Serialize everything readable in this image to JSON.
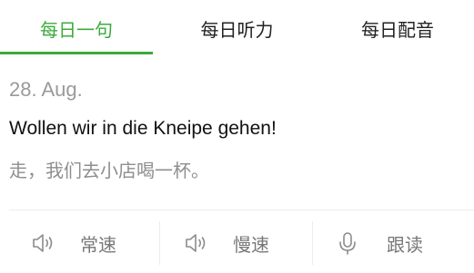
{
  "tabs": [
    {
      "label": "每日一句",
      "active": true
    },
    {
      "label": "每日听力",
      "active": false
    },
    {
      "label": "每日配音",
      "active": false
    }
  ],
  "card": {
    "date": "28. Aug.",
    "sentence": "Wollen wir in die Kneipe gehen!",
    "translation": "走，我们去小店喝一杯。"
  },
  "actions": [
    {
      "label": "常速",
      "icon": "speaker-icon"
    },
    {
      "label": "慢速",
      "icon": "speaker-icon"
    },
    {
      "label": "跟读",
      "icon": "microphone-icon"
    }
  ],
  "colors": {
    "accent": "#3bab3b",
    "text": "#111111",
    "muted": "#9a9a9a"
  }
}
